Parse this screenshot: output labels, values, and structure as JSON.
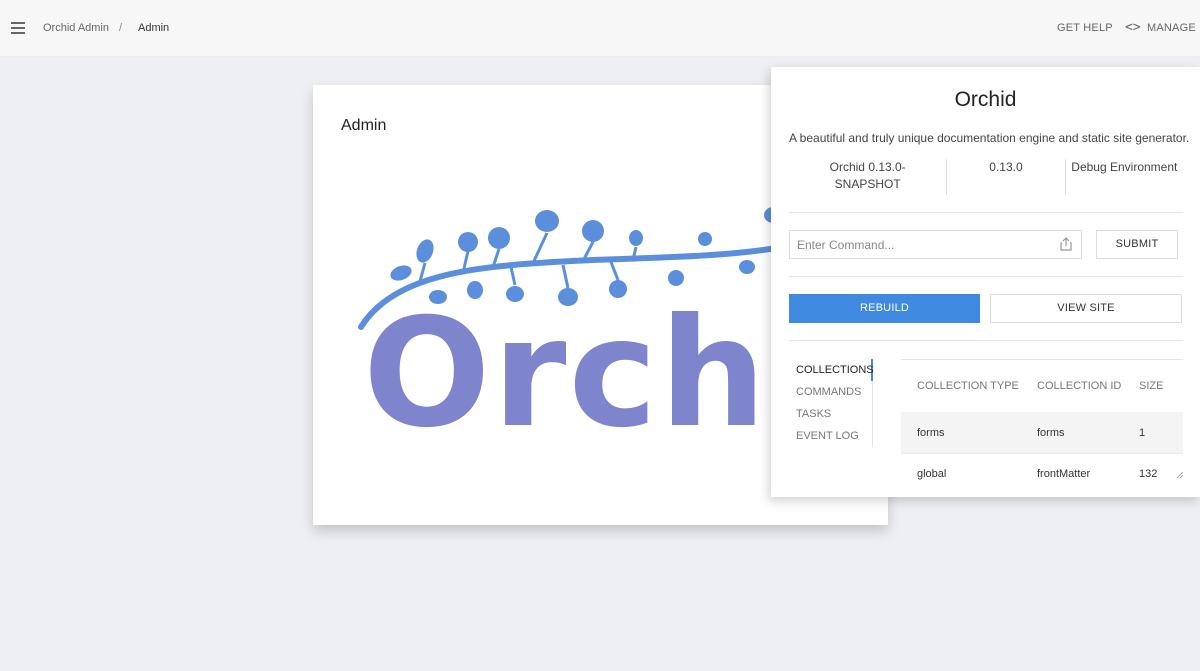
{
  "header": {
    "breadcrumb_home": "Orchid Admin",
    "breadcrumb_separator": "/",
    "breadcrumb_current": "Admin",
    "get_help": "GET HELP",
    "manage": "MANAGE"
  },
  "admin_card": {
    "title": "Admin",
    "logo_text": "Orchid"
  },
  "panel": {
    "title": "Orchid",
    "description": "A beautiful and truly unique documentation engine and static site generator.",
    "info": [
      "Orchid 0.13.0-SNAPSHOT",
      "0.13.0",
      "Debug Environment"
    ],
    "command_placeholder": "Enter Command...",
    "submit_label": "SUBMIT",
    "rebuild_label": "REBUILD",
    "view_site_label": "VIEW SITE",
    "tabs": [
      "COLLECTIONS",
      "COMMANDS",
      "TASKS",
      "EVENT LOG"
    ],
    "table": {
      "headers": [
        "COLLECTION TYPE",
        "COLLECTION ID",
        "SIZE"
      ],
      "rows": [
        [
          "forms",
          "forms",
          "1"
        ],
        [
          "global",
          "frontMatter",
          "132"
        ]
      ]
    }
  },
  "colors": {
    "accent": "#3f8ae0",
    "logo_text": "#7f85cc",
    "logo_vine": "#5b8fdc",
    "background": "#eeeff3"
  }
}
